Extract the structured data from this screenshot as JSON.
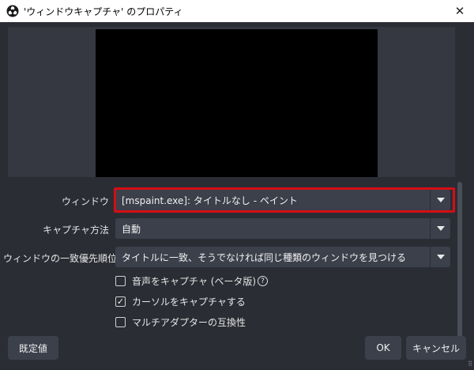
{
  "window": {
    "title": "'ウィンドウキャプチャ' のプロパティ",
    "close_label": "✕"
  },
  "form": {
    "window_label": "ウィンドウ",
    "window_value": "[mspaint.exe]: タイトルなし - ペイント",
    "capture_method_label": "キャプチャ方法",
    "capture_method_value": "自動",
    "match_priority_label": "ウィンドウの一致優先順位",
    "match_priority_value": "タイトルに一致、そうでなければ同じ種類のウィンドウを見つける"
  },
  "checkboxes": [
    {
      "label": "音声をキャプチャ (ベータ版)",
      "checked": false,
      "mark": ""
    },
    {
      "label": "カーソルをキャプチャする",
      "checked": true,
      "mark": "✓"
    },
    {
      "label": "マルチアダプターの互換性",
      "checked": false,
      "mark": ""
    }
  ],
  "help_glyph": "?",
  "buttons": {
    "defaults": "既定値",
    "ok": "OK",
    "cancel": "キャンセル"
  },
  "colors": {
    "highlight": "#d40e14",
    "client_bg": "#2b2d34",
    "control_bg": "#3c404b"
  },
  "icons": [
    "obs-icon",
    "close-icon",
    "dropdown-arrow-icon",
    "checkmark-icon",
    "help-icon",
    "resize-grip-icon"
  ]
}
